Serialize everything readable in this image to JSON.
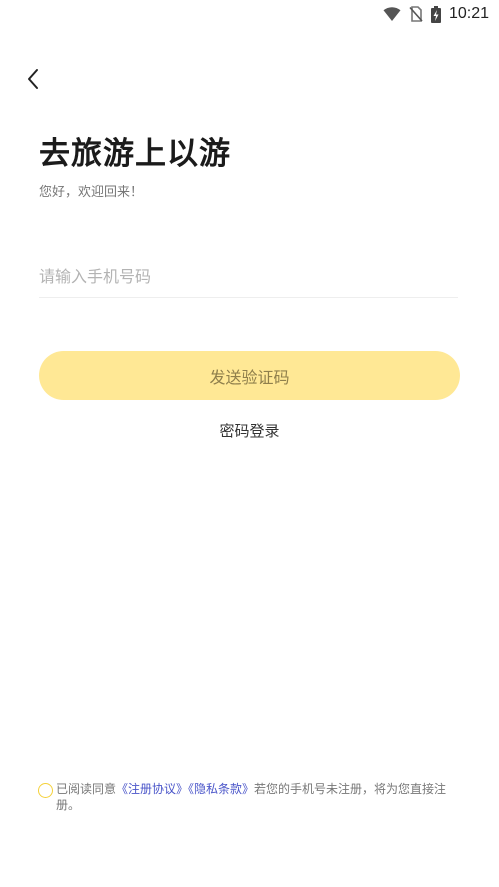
{
  "status_bar": {
    "time": "10:21",
    "icons": [
      "wifi-icon",
      "no-sim-icon",
      "battery-charging-icon"
    ]
  },
  "nav": {
    "back_icon": "chevron-left-icon"
  },
  "header": {
    "title": "去旅游上以游",
    "subtitle": "您好，欢迎回来！"
  },
  "form": {
    "phone_placeholder": "请输入手机号码",
    "phone_value": "",
    "send_code_label": "发送验证码",
    "password_login_label": "密码登录"
  },
  "agreement": {
    "checked": false,
    "prefix": "已阅读同意",
    "terms_link": "《注册协议》",
    "privacy_link": "《隐私条款》",
    "suffix": "若您的手机号未注册，将为您直接注册。"
  },
  "colors": {
    "accent": "#FFE895",
    "accent_border": "#F4D13A",
    "link": "#4A55C9",
    "send_button_text": "#8F7F4C"
  }
}
